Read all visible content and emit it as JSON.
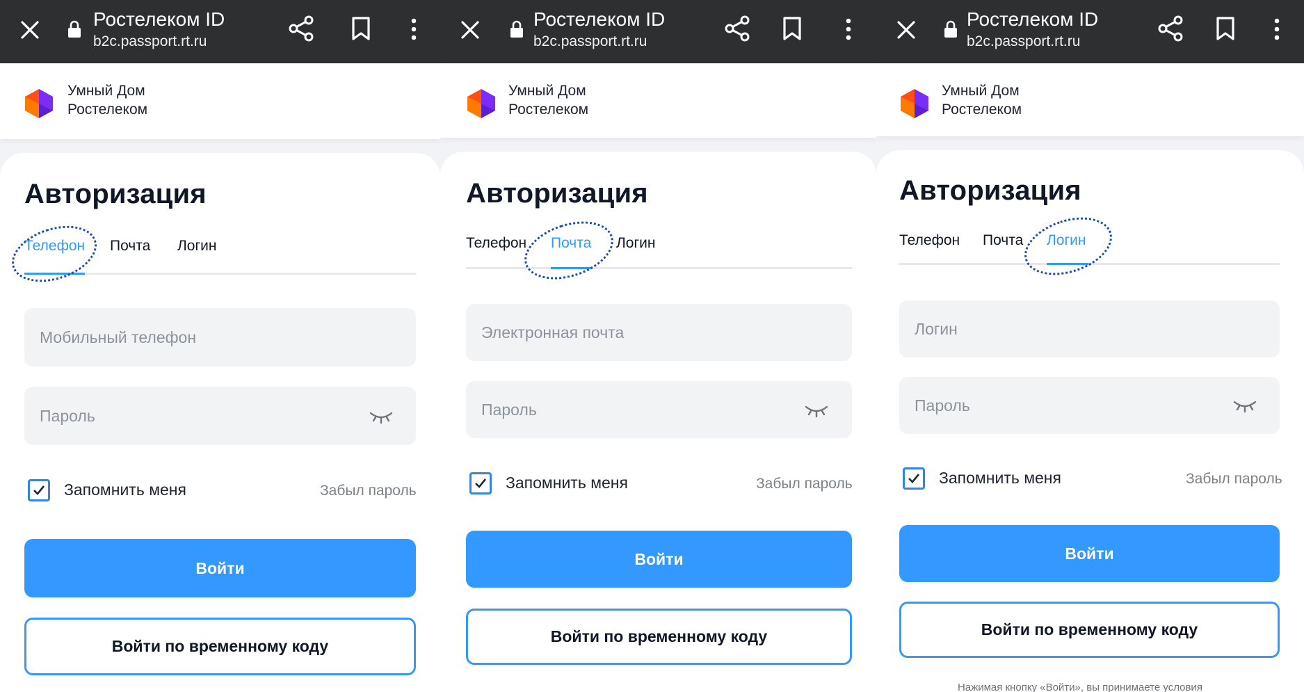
{
  "browser": {
    "title": "Ростелеком ID",
    "url": "b2c.passport.rt.ru"
  },
  "app": {
    "brand_line1": "Умный Дом",
    "brand_line2": "Ростелеком"
  },
  "colors": {
    "accent": "#3398ff",
    "annotation": "#1d4fa0",
    "toolbar": "#2d2f31"
  },
  "heading": "Авторизация",
  "tabs": {
    "phone": "Телефон",
    "mail": "Почта",
    "login": "Логин"
  },
  "password_placeholder": "Пароль",
  "remember_label": "Запомнить меня",
  "forgot_label": "Забыл пароль",
  "submit_label": "Войти",
  "temp_code_label": "Войти по временному коду",
  "panels": [
    {
      "active_tab": "Телефон",
      "input_placeholder": "Мобильный телефон",
      "remember_checked": true
    },
    {
      "active_tab": "Почта",
      "input_placeholder": "Электронная почта",
      "remember_checked": true
    },
    {
      "active_tab": "Логин",
      "input_placeholder": "Логин",
      "remember_checked": true,
      "legal_text": "Нажимая кнопку «Войти», вы принимаете условия"
    }
  ],
  "icons": [
    "close-icon",
    "lock-icon",
    "share-icon",
    "bookmark-icon",
    "more-icon",
    "rostelecom-logo-icon",
    "eye-closed-icon",
    "checkmark-icon"
  ]
}
